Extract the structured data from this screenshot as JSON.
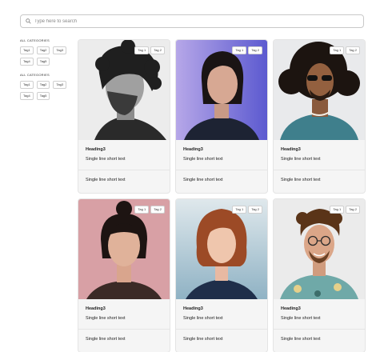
{
  "search": {
    "placeholder": "Type here to search"
  },
  "sidebar": {
    "groups": [
      {
        "title": "ALL CATEGORIES",
        "tags": [
          "Tag1",
          "Tag2",
          "Tag3",
          "Tag4",
          "Tag5"
        ]
      },
      {
        "title": "ALL CATEGORIES",
        "tags": [
          "Tag1",
          "Tag2",
          "Tag3",
          "Tag4",
          "Tag5"
        ]
      }
    ]
  },
  "cards": [
    {
      "tag1": "Tag 1",
      "tag2": "Tag 2",
      "heading": "Heading3",
      "text1": "Single line short text",
      "text2": "Single line short text",
      "photo_bg": "#e9e9e9"
    },
    {
      "tag1": "Tag 1",
      "tag2": "Tag 2",
      "heading": "Heading3",
      "text1": "Single line short text",
      "text2": "Single line short text",
      "photo_bg": "#7b73d6"
    },
    {
      "tag1": "Tag 1",
      "tag2": "Tag 2",
      "heading": "Heading3",
      "text1": "Single line short text",
      "text2": "Single line short text",
      "photo_bg": "#e6e8ea"
    },
    {
      "tag1": "Tag 1",
      "tag2": "Tag 2",
      "heading": "Heading3",
      "text1": "Single line short text",
      "text2": "Single line short text",
      "photo_bg": "#d9a3a6"
    },
    {
      "tag1": "Tag 1",
      "tag2": "Tag 2",
      "heading": "Heading3",
      "text1": "Single line short text",
      "text2": "Single line short text",
      "photo_bg": "#c9dbe5"
    },
    {
      "tag1": "Tag 1",
      "tag2": "Tag 2",
      "heading": "Heading3",
      "text1": "Single line short text",
      "text2": "Single line short text",
      "photo_bg": "#e7e7e7"
    }
  ]
}
